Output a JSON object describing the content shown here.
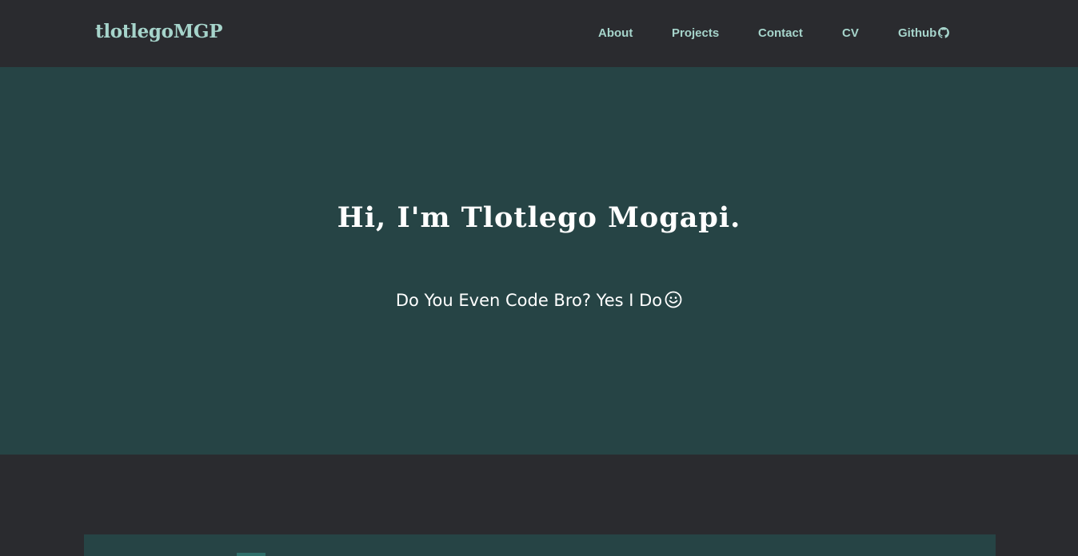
{
  "navbar": {
    "brand": "tlotlegoMGP",
    "links": [
      {
        "label": "About"
      },
      {
        "label": "Projects"
      },
      {
        "label": "Contact"
      },
      {
        "label": "CV"
      },
      {
        "label": "Github",
        "icon": "github-icon"
      }
    ]
  },
  "hero": {
    "title": "Hi, I'm Tlotlego Mogapi.",
    "subtitle": "Do You Even Code Bro? Yes I Do",
    "subtitle_icon": "smile-icon"
  },
  "colors": {
    "page_background": "#2a2b2f",
    "hero_background": "#264445",
    "accent_text": "#a6d4cb",
    "hero_text": "#ffffff"
  }
}
